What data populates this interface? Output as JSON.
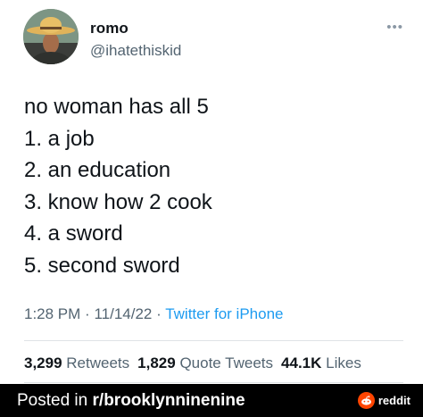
{
  "tweet": {
    "display_name": "romo",
    "handle": "@ihatethiskid",
    "more_icon": "ellipsis-icon",
    "body_lines": [
      "no woman has all 5",
      "1. a job",
      "2. an education",
      "3. know how 2 cook",
      "4. a sword",
      "5. second sword"
    ],
    "time": "1:28 PM",
    "date": "11/14/22",
    "separator": "·",
    "source": "Twitter for iPhone",
    "stats": {
      "retweets_count": "3,299",
      "retweets_label": "Retweets",
      "quote_count": "1,829",
      "quote_label": "Quote Tweets",
      "likes_count": "44.1K",
      "likes_label": "Likes"
    }
  },
  "footer": {
    "posted_in": "Posted in",
    "subreddit": "r/brooklynninenine",
    "brand": "reddit",
    "brand_color": "#ff4500"
  },
  "colors": {
    "text": "#0f1419",
    "secondary": "#536471",
    "link": "#1d9bf0",
    "footer_bg": "#000000"
  }
}
